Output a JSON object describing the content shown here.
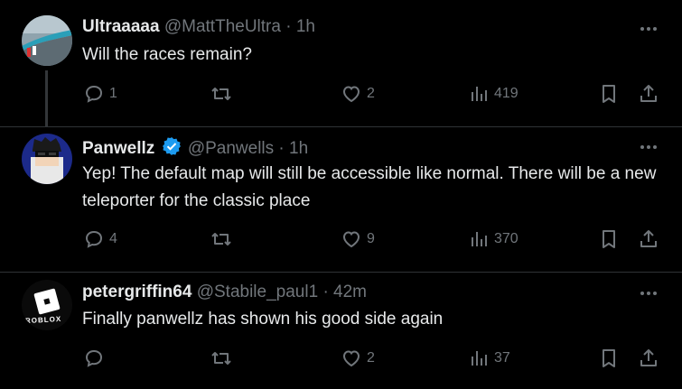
{
  "tweets": [
    {
      "name": "Ultraaaaa",
      "handle": "@MattTheUltra",
      "time": "1h",
      "text": "Will the races remain?",
      "replies": "1",
      "reposts": "",
      "likes": "2",
      "views": "419"
    },
    {
      "name": "Panwellz",
      "handle": "@Panwells",
      "time": "1h",
      "text": "Yep! The default map will still be accessible like normal. There will be a new teleporter for the classic place",
      "replies": "4",
      "reposts": "",
      "likes": "9",
      "views": "370"
    },
    {
      "name": "petergriffin64",
      "handle": "@Stabile_paul1",
      "time": "42m",
      "text": "Finally panwellz has shown his good side again",
      "replies": "",
      "reposts": "",
      "likes": "2",
      "views": "37"
    }
  ],
  "separator": "·",
  "avatar_logo_text": "ROBLOX",
  "colors": {
    "background": "#000000",
    "text": "#e7e9ea",
    "muted": "#71767b",
    "verified": "#1d9bf0"
  }
}
